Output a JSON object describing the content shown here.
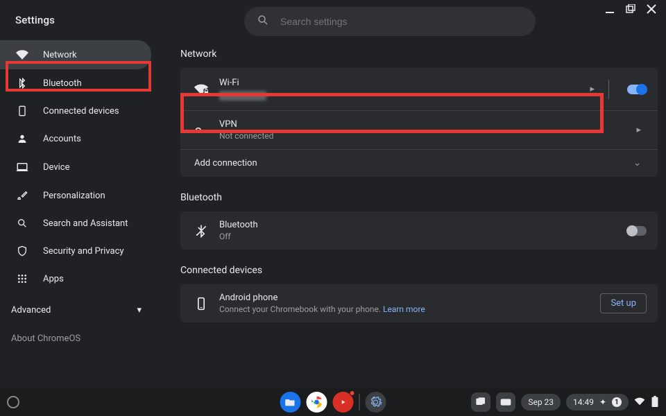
{
  "window": {
    "title": "Settings"
  },
  "search": {
    "placeholder": "Search settings"
  },
  "sidebar": {
    "items": [
      {
        "label": "Network"
      },
      {
        "label": "Bluetooth"
      },
      {
        "label": "Connected devices"
      },
      {
        "label": "Accounts"
      },
      {
        "label": "Device"
      },
      {
        "label": "Personalization"
      },
      {
        "label": "Search and Assistant"
      },
      {
        "label": "Security and Privacy"
      },
      {
        "label": "Apps"
      }
    ],
    "advanced": "Advanced",
    "about": "About ChromeOS"
  },
  "sections": {
    "network": {
      "title": "Network",
      "wifi": {
        "label": "Wi-Fi",
        "on": true
      },
      "vpn": {
        "label": "VPN",
        "status": "Not connected"
      },
      "add": "Add connection"
    },
    "bluetooth": {
      "title": "Bluetooth",
      "row": {
        "label": "Bluetooth",
        "status": "Off",
        "on": false
      }
    },
    "connected": {
      "title": "Connected devices",
      "phone": {
        "label": "Android phone",
        "desc_prefix": "Connect your Chromebook with your phone. ",
        "learn": "Learn more"
      },
      "setup": "Set up"
    }
  },
  "shelf": {
    "date": "Sep 23",
    "time": "14:49",
    "notif_count": "1"
  }
}
